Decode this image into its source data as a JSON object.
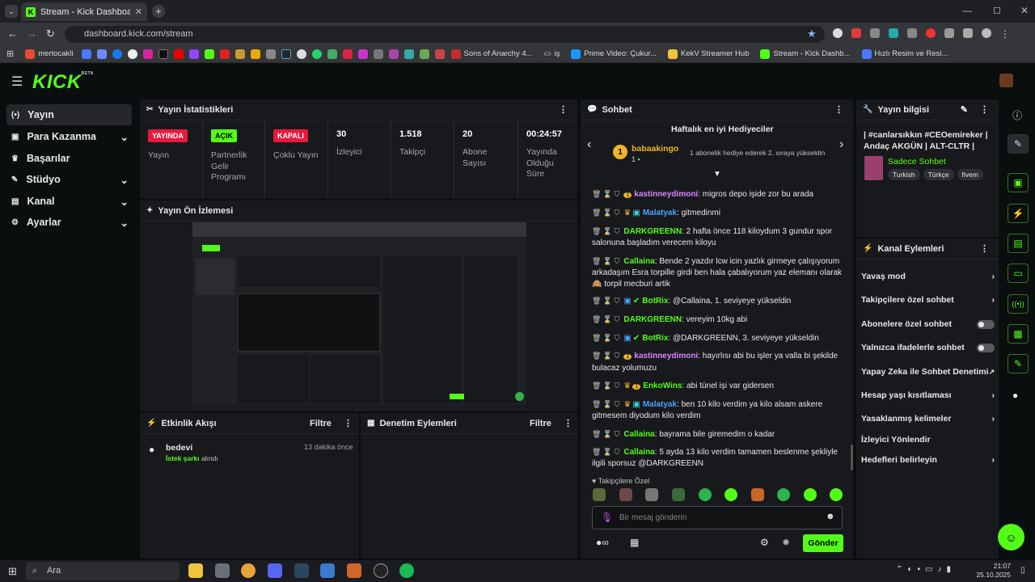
{
  "browser": {
    "tab_title": "Stream - Kick Dashboard",
    "url": "dashboard.kick.com/stream"
  },
  "bookmarks": [
    {
      "label": "mertocakli",
      "color": "#e84a2c"
    },
    {
      "label": "Sons of Anarchy 4...",
      "color": "#c42d2d"
    },
    {
      "label": "iş",
      "color": "#8a8a8a"
    },
    {
      "label": "Prime Video: Çukur...",
      "color": "#1a98ff"
    },
    {
      "label": "KekV Streamer Hub",
      "color": "#f0c43b"
    },
    {
      "label": "Stream - Kick Dashb...",
      "color": "#53fc18"
    },
    {
      "label": "Hızlı Resim ve Resi...",
      "color": "#4a7aff"
    }
  ],
  "header": {
    "logo": "KICK",
    "beta": "BETA"
  },
  "sidebar": {
    "items": [
      {
        "label": "Yayın",
        "icon": "broadcast-icon",
        "active": true
      },
      {
        "label": "Para Kazanma",
        "icon": "money-icon",
        "expandable": true
      },
      {
        "label": "Başarılar",
        "icon": "trophy-icon"
      },
      {
        "label": "Stüdyo",
        "icon": "studio-icon",
        "expandable": true
      },
      {
        "label": "Kanal",
        "icon": "channel-icon",
        "expandable": true
      },
      {
        "label": "Ayarlar",
        "icon": "gear-icon",
        "expandable": true
      }
    ]
  },
  "stats": {
    "title": "Yayın İstatistikleri",
    "cols": [
      {
        "badge": "YAYINDA",
        "badge_color": "#e8193c",
        "label": "Yayın"
      },
      {
        "badge": "AÇIK",
        "badge_color": "#53fc18",
        "label": "Partnerlik Gelir Programı"
      },
      {
        "badge": "KAPALI",
        "badge_color": "#e8193c",
        "label": "Çoklu Yayın"
      },
      {
        "value": "30",
        "label": "İzleyici"
      },
      {
        "value": "1.518",
        "label": "Takipçi"
      },
      {
        "value": "20",
        "label": "Abone Sayısı"
      },
      {
        "value": "00:24:57",
        "label": "Yayında Olduğu Süre"
      }
    ]
  },
  "preview": {
    "title": "Yayın Ön İzlemesi"
  },
  "activity": {
    "title": "Etkinlik Akışı",
    "filter": "Filtre",
    "item": {
      "user": "bedevi",
      "action_green": "İstek şarkı",
      "action_rest": "alındı",
      "time": "13 dakika önce"
    }
  },
  "moderation": {
    "title": "Denetim Eylemleri",
    "filter": "Filtre"
  },
  "chat": {
    "title": "Sohbet",
    "gifters_title": "Haftalık en iyi Hediyeciler",
    "top_gifter": {
      "name": "babaakingo",
      "count": "1",
      "info": "1 abonelik hediye ederek 2. sıraya yükseldin"
    },
    "messages": [
      {
        "user": "kastinneydimoni",
        "color": "#d884ff",
        "text": "migros depo işide zor bu arada",
        "badges": [
          "sub"
        ]
      },
      {
        "user": "Malatyak",
        "color": "#4aa3ff",
        "text": "gitmedinmi",
        "badges": [
          "crown",
          "vip"
        ]
      },
      {
        "user": "DARKGREENN",
        "color": "#53fc18",
        "text": "2 hafta önce 118 kiloydum 3 gundur spor salonuna başladım verecem kiloyu"
      },
      {
        "user": "Callaina",
        "color": "#53fc18",
        "text": "Bende 2 yazdır lcw icin yazlık girmeye çalışıyorum arkadaşım Esra torpille girdi ben hala çabalıyorum yaz elemanı olarak 🙈 torpil mecburi artik"
      },
      {
        "user": "BotRix",
        "color": "#53fc18",
        "text": "@Callaina, 1. seviyeye yükseldin",
        "badges": [
          "bot",
          "verified"
        ]
      },
      {
        "user": "DARKGREENN",
        "color": "#53fc18",
        "text": "vereyim 10kg abi"
      },
      {
        "user": "BotRix",
        "color": "#53fc18",
        "text": "@DARKGREENN, 3. seviyeye yükseldin",
        "badges": [
          "bot",
          "verified"
        ]
      },
      {
        "user": "kastinneydimoni",
        "color": "#d884ff",
        "text": "hayırlısı abi bu işler ya valla bi şekilde bulacaz yolumuzu",
        "badges": [
          "sub"
        ]
      },
      {
        "user": "EnkoWins",
        "color": "#53fc18",
        "text": "abi tünel işi var gidersen",
        "badges": [
          "crown",
          "sub"
        ]
      },
      {
        "user": "Malatyak",
        "color": "#4aa3ff",
        "text": "ben 10 kilo verdim ya kilo alsam askere gitmesem diyodum kilo verdim",
        "badges": [
          "crown",
          "vip"
        ]
      },
      {
        "user": "Callaina",
        "color": "#53fc18",
        "text": "bayrama bile giremedim o kadar"
      },
      {
        "user": "Callaina",
        "color": "#53fc18",
        "text": "5 ayda 13 kilo verdim tamamen beslenme şekliyle ilgili sporsuz @DARKGREENN"
      }
    ],
    "emote_section": "Takipçilere Özel",
    "input_placeholder": "Bir mesaj gönderin",
    "send": "Gönder"
  },
  "stream_info": {
    "title_label": "Yayın bilgisi",
    "stream_title": "| #canlarsıkkın #CEOemireker | Andaç AKGÜN | ALT-CLTR | KEK...",
    "category": "Sadece Sohbet",
    "tags": [
      "Turkish",
      "Türkçe",
      "fivem"
    ]
  },
  "channel_actions": {
    "title": "Kanal Eylemleri",
    "items": [
      {
        "label": "Yavaş mod",
        "type": "arrow"
      },
      {
        "label": "Takipçilere özel sohbet",
        "type": "arrow"
      },
      {
        "label": "Abonelere özel sohbet",
        "type": "toggle"
      },
      {
        "label": "Yalnızca ifadelerle sohbet",
        "type": "toggle"
      },
      {
        "label": "Yapay Zeka ile Sohbet Denetimi",
        "type": "external"
      },
      {
        "label": "Hesap yaşı kısıtlaması",
        "type": "arrow"
      },
      {
        "label": "Yasaklanmış kelimeler",
        "type": "arrow"
      },
      {
        "label": "İzleyici Yönlendir",
        "type": "none"
      },
      {
        "label": "Hedefleri belirleyin",
        "type": "arrow"
      }
    ]
  },
  "taskbar": {
    "search": "Ara",
    "time": "21:07",
    "date": "25.10.2025"
  }
}
